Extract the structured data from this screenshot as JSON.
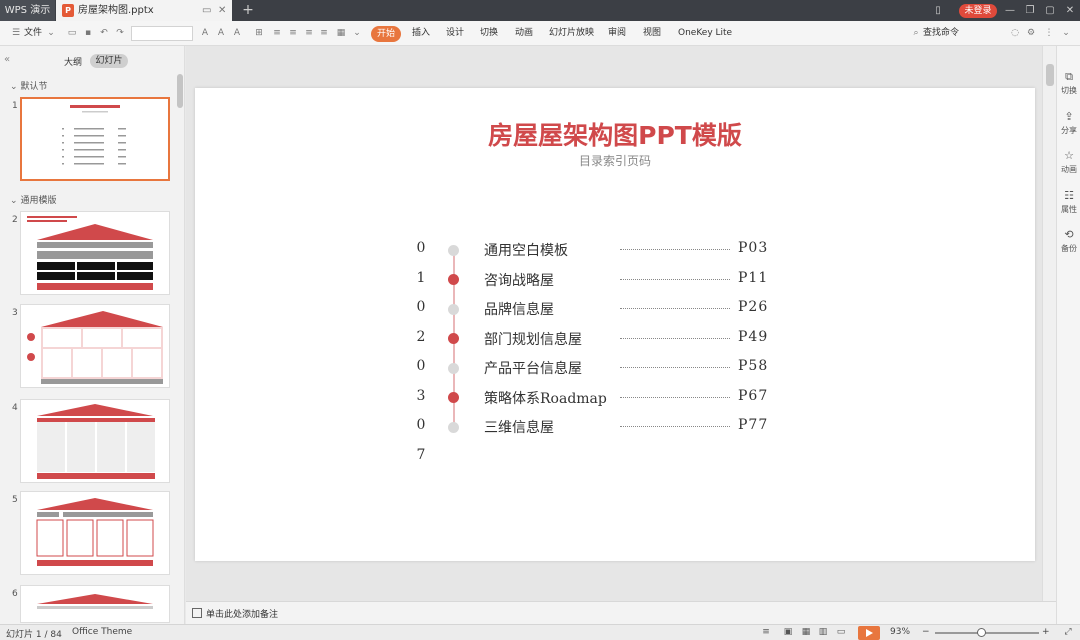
{
  "titlebar": {
    "app_label": "WPS 演示",
    "doc_tab": "房屋架构图.pptx",
    "add_tab": "+",
    "login": "未登录"
  },
  "toolbar": {
    "file_menu": "文件",
    "tabs": [
      "开始",
      "插入",
      "设计",
      "切换",
      "动画",
      "幻灯片放映",
      "审阅",
      "视图",
      "OneKey Lite"
    ],
    "active_tab": "开始",
    "search_command": "查找命令"
  },
  "left_panel": {
    "tab_outline": "大纲",
    "tab_slides": "幻灯片",
    "section_default": "默认节",
    "section_common": "通用模版",
    "slide_numbers": [
      "1",
      "2",
      "3",
      "4",
      "5",
      "6"
    ]
  },
  "slide": {
    "title": "房屋屋架构图PPT模版",
    "subtitle": "目录索引页码",
    "digits": [
      "0",
      "1",
      "0",
      "2",
      "0",
      "3",
      "0",
      "7"
    ],
    "items": [
      {
        "label": "通用空白模板",
        "page": "P03",
        "highlight": false
      },
      {
        "label": "咨询战略屋",
        "page": "P11",
        "highlight": true
      },
      {
        "label": "品牌信息屋",
        "page": "P26",
        "highlight": false
      },
      {
        "label": "部门规划信息屋",
        "page": "P49",
        "highlight": true
      },
      {
        "label": "产品平台信息屋",
        "page": "P58",
        "highlight": false
      },
      {
        "label": "策略体系Roadmap",
        "page": "P67",
        "highlight": true
      },
      {
        "label": "三维信息屋",
        "page": "P77",
        "highlight": false
      }
    ],
    "title_color": "#d0494b",
    "dot_active_color": "#d0494b",
    "dot_inactive_color": "#d9d9d9"
  },
  "right_panel": {
    "items": [
      {
        "icon": "switch-icon",
        "label": "切换"
      },
      {
        "icon": "share-icon",
        "label": "分享"
      },
      {
        "icon": "animation-icon",
        "label": "动画"
      },
      {
        "icon": "properties-icon",
        "label": "属性"
      },
      {
        "icon": "backup-icon",
        "label": "备份"
      }
    ]
  },
  "notes": {
    "placeholder": "单击此处添加备注"
  },
  "status": {
    "slide_counter": "幻灯片 1 / 84",
    "theme": "Office Theme",
    "zoom": "93%",
    "zoom_minus": "−",
    "zoom_plus": "+"
  },
  "colors": {
    "accent": "#e8763e",
    "brand_red": "#d0494b"
  }
}
